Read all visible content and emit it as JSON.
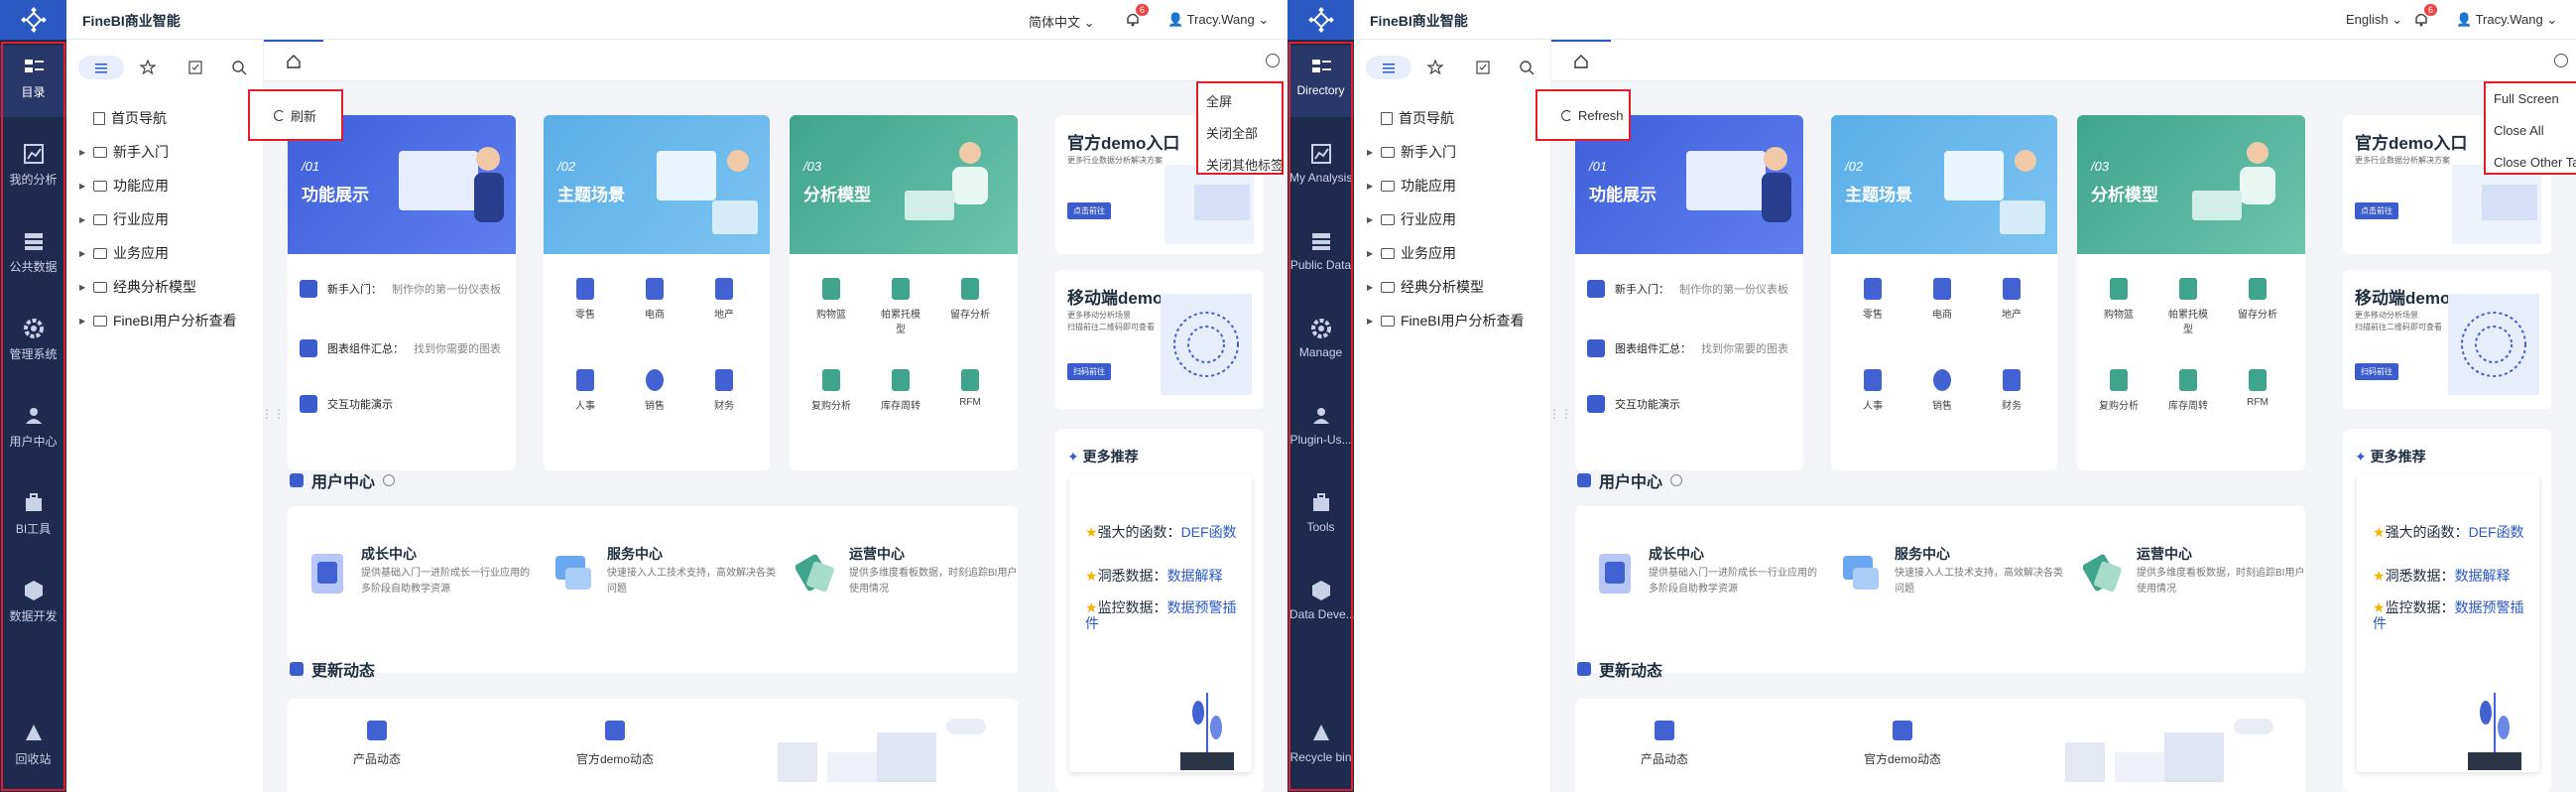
{
  "left": {
    "brand": "FineBI商业智能",
    "language": "简体中文",
    "notif_count": "6",
    "user": "Tracy.Wang",
    "rail": [
      "目录",
      "我的分析",
      "公共数据",
      "管理系统",
      "用户中心",
      "BI工具",
      "数据开发",
      "回收站"
    ],
    "tree": [
      "首页导航",
      "新手入门",
      "功能应用",
      "行业应用",
      "业务应用",
      "经典分析模型",
      "FineBI用户分析查看"
    ],
    "refresh": "刷新",
    "tab_menu": [
      "全屏",
      "关闭全部",
      "关闭其他标签"
    ],
    "hero": [
      {
        "num": "/01",
        "title": "功能展示"
      },
      {
        "num": "/02",
        "title": "主题场景"
      },
      {
        "num": "/03",
        "title": "分析模型"
      }
    ],
    "features": [
      {
        "b": "新手入门：",
        "i": "制作你的第一份仪表板"
      },
      {
        "b": "图表组件汇总：",
        "i": "找到你需要的图表"
      },
      {
        "b": "交互功能演示",
        "i": ""
      }
    ],
    "scenes": [
      "零售",
      "电商",
      "地产",
      "人事",
      "销售",
      "财务"
    ],
    "models": [
      "购物篮",
      "帕累托模型",
      "留存分析",
      "复购分析",
      "库存周转",
      "RFM"
    ],
    "promo1": {
      "title": "官方demo入口",
      "desc": "更多行业数据分析解决方案",
      "btn": "点击前往"
    },
    "promo2": {
      "title": "移动端demo",
      "desc1": "更多移动分析场景",
      "desc2": "扫描前往二维码即可查看",
      "btn": "扫码前往"
    },
    "uc_title": "用户中心",
    "uc": [
      {
        "t": "成长中心",
        "d": "提供基础入门一进阶成长一行业应用的多阶段自助教学资源"
      },
      {
        "t": "服务中心",
        "d": "快速接入人工技术支持，高效解决各类问题"
      },
      {
        "t": "运营中心",
        "d": "提供多维度看板数据，时刻追踪BI用户使用情况"
      }
    ],
    "news_title": "更新动态",
    "news": [
      "产品动态",
      "官方demo动态"
    ],
    "more_title": "更多推荐",
    "recs": [
      {
        "k": "强大的函数：",
        "v": "DEF函数"
      },
      {
        "k": "洞悉数据：",
        "v": "数据解释"
      },
      {
        "k": "监控数据：",
        "v": "数据预警插件"
      }
    ]
  },
  "right": {
    "brand": "FineBI商业智能",
    "language": "English",
    "notif_count": "6",
    "user": "Tracy.Wang",
    "rail": [
      "Directory",
      "My Analysis",
      "Public Data",
      "Manage",
      "Plugin-Us...",
      "Tools",
      "Data Deve...",
      "Recycle bin"
    ],
    "tree": [
      "首页导航",
      "新手入门",
      "功能应用",
      "行业应用",
      "业务应用",
      "经典分析模型",
      "FineBI用户分析查看"
    ],
    "refresh": "Refresh",
    "tab_menu": [
      "Full Screen",
      "Close All",
      "Close Other Tabs"
    ]
  }
}
